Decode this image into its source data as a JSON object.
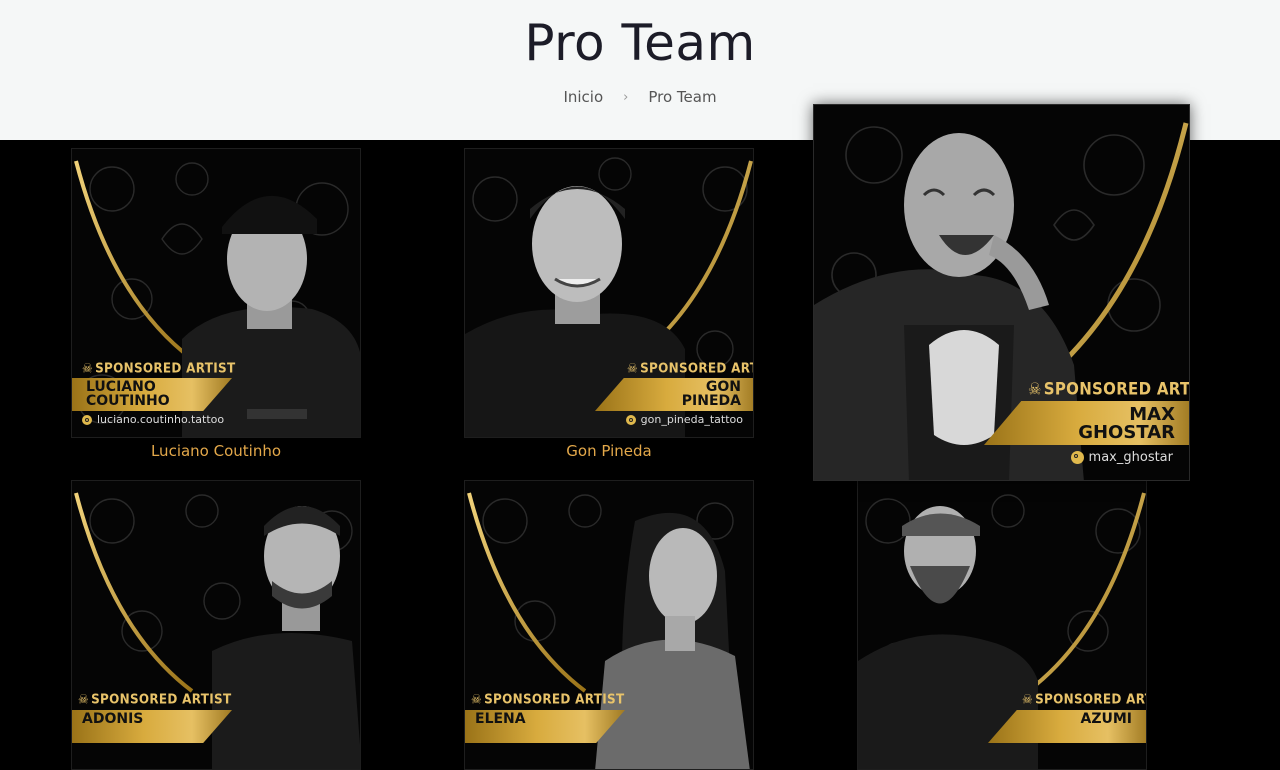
{
  "page": {
    "title": "Pro Team"
  },
  "breadcrumb": {
    "home": "Inicio",
    "current": "Pro Team"
  },
  "sponsor_label": "SPONSORED ARTIST",
  "artists": [
    {
      "card_name": "LUCIANO\nCOUTINHO",
      "handle": "luciano.coutinho.tattoo",
      "caption": "Luciano Coutinho"
    },
    {
      "card_name": "GON\nPINEDA",
      "handle": "gon_pineda_tattoo",
      "caption": "Gon Pineda"
    },
    {
      "card_name": "MAX\nGHOSTAR",
      "handle": "max_ghostar",
      "caption": ""
    },
    {
      "card_name": "ADONIS",
      "handle": "",
      "caption": ""
    },
    {
      "card_name": "ELENA",
      "handle": "",
      "caption": ""
    },
    {
      "card_name": "AZUMI",
      "handle": "",
      "caption": ""
    }
  ],
  "colors": {
    "gold": "#e3a84a",
    "background": "#000000",
    "hero_bg": "#f5f7f7"
  }
}
